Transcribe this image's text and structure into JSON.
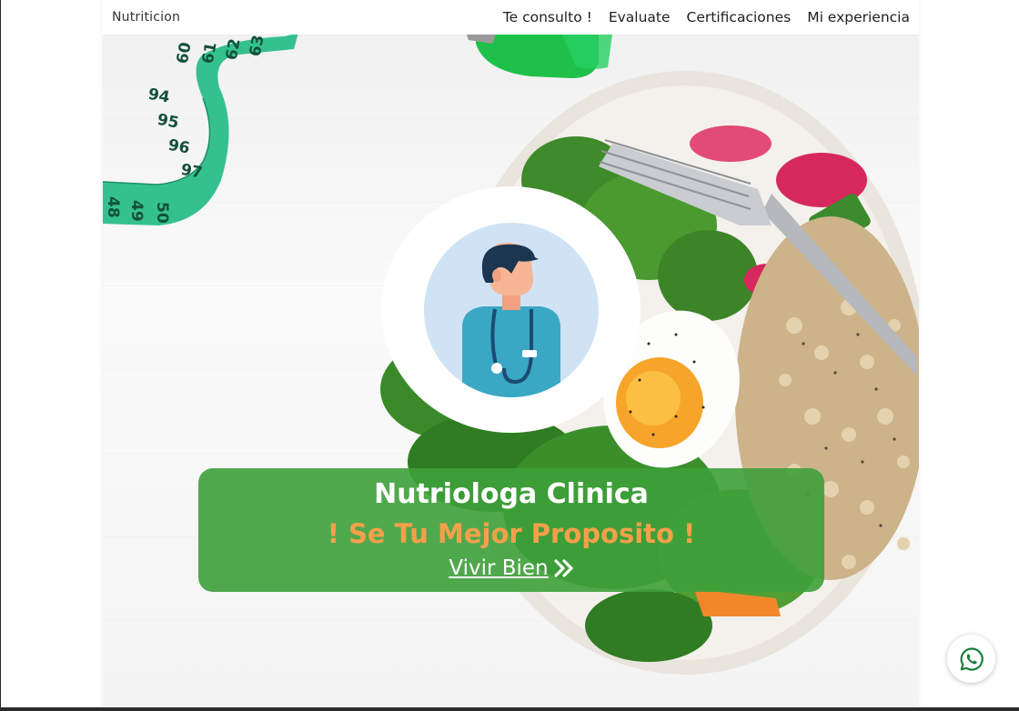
{
  "brand": "Nutriticion",
  "nav": {
    "items": [
      {
        "label": "Te consulto !"
      },
      {
        "label": "Evaluate"
      },
      {
        "label": "Certificaciones"
      },
      {
        "label": "Mi experiencia"
      }
    ]
  },
  "hero": {
    "title": "Nutriologa Clinica",
    "subtitle": "! Se Tu Mejor Proposito !",
    "cta_label": "Vivir Bien",
    "cta_icon": "double-chevron-right-icon",
    "tape_numbers": [
      "48",
      "49",
      "50",
      "94",
      "95",
      "96",
      "97",
      "60",
      "61",
      "62",
      "63"
    ]
  },
  "colors": {
    "banner": "#3ea03a",
    "accent": "#f6a04a",
    "tape": "#34c38f"
  },
  "widgets": {
    "whatsapp_icon": "whatsapp-icon"
  }
}
